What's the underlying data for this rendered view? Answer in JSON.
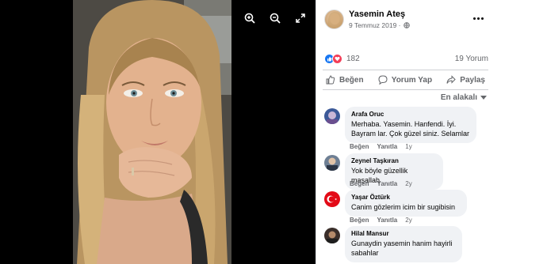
{
  "post": {
    "author": "Yasemin Ateş",
    "date": "9 Temmuz 2019 · ",
    "privacy_icon": "globe-icon"
  },
  "viewer": {
    "tools": [
      "zoom-in-icon",
      "zoom-out-icon",
      "fullscreen-icon"
    ]
  },
  "stats": {
    "reactions": "182",
    "comments": "19 Yorum",
    "reaction_types": [
      "like",
      "love"
    ]
  },
  "actions": {
    "like": "Beğen",
    "comment": "Yorum Yap",
    "share": "Paylaş"
  },
  "sort": {
    "label": "En alakalı"
  },
  "comments": [
    {
      "name": "Arafa Oruc",
      "text1": "Merhaba. Yasemin. Hanfendi. İyi.",
      "text2": "Bayram lar. Çok güzel siniz. Selamlar",
      "like": "Beğen",
      "reply": "Yanıtla",
      "age": "1y"
    },
    {
      "name": "Zeynel Taşkıran",
      "text1": "Yok böyle güzellik maşallah",
      "like": "Beğen",
      "reply": "Yanıtla",
      "age": "2y"
    },
    {
      "name": "Yaşar Öztürk",
      "text1": "Canim gözlerim icim bir sugibisin",
      "like": "Beğen",
      "reply": "Yanıtla",
      "age": "2y"
    },
    {
      "name": "Hilal Mansur",
      "text1": "Gunaydin yasemin hanim hayirli",
      "text2": "sabahlar"
    }
  ],
  "colors": {
    "accent": "#1877f2",
    "love": "#f33e58",
    "muted": "#65676b",
    "bubble": "#f0f2f5"
  }
}
